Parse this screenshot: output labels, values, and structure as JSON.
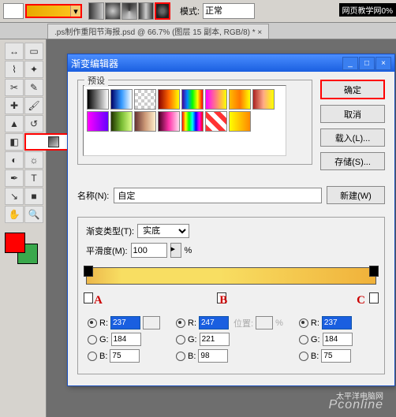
{
  "topbar": {
    "mode_label": "模式:",
    "mode_value": "正常",
    "watermark": "网页教学网0%"
  },
  "tab": {
    "title": ".ps制作重阳节海报.psd @ 66.7% (图层 15 副本, RGB/8) * ×"
  },
  "dialog": {
    "title": "渐变编辑器",
    "preset_legend": "预设",
    "buttons": {
      "ok": "确定",
      "cancel": "取消",
      "load": "载入(L)...",
      "save": "存储(S)...",
      "new": "新建(W)"
    },
    "name_label": "名称(N):",
    "name_value": "自定",
    "grad_type_label": "渐变类型(T):",
    "grad_type_value": "实底",
    "smooth_label": "平滑度(M):",
    "smooth_value": "100",
    "smooth_unit": "%",
    "stops_extra": {
      "pos_label": "位置:",
      "pct": "%"
    },
    "marks": {
      "a": "A",
      "b": "B",
      "c": "C"
    },
    "rgb": {
      "a": {
        "r": "237",
        "g": "184",
        "b": "75"
      },
      "b": {
        "r": "247",
        "g": "221",
        "b": "98"
      },
      "c": {
        "r": "237",
        "g": "184",
        "b": "75"
      }
    }
  },
  "watermark": {
    "brand": "Pconline",
    "sub": "太平洋电脑网"
  },
  "presets_css": [
    "linear-gradient(90deg,#000,#fff)",
    "linear-gradient(90deg,#006,#39f,#fff)",
    "repeating-conic-gradient(#ccc 0 25%,#fff 0 50%) 0/8px 8px",
    "linear-gradient(90deg,#800,#f60,#ff0)",
    "linear-gradient(90deg,#409,#08f,#0f0,#ff0,#f00)",
    "linear-gradient(90deg,#f0f,#ff0)",
    "linear-gradient(90deg,#fb0,#f70,#ff0)",
    "linear-gradient(90deg,#a22,#fa8,#ff0)",
    "linear-gradient(90deg,#f0f,#60f)",
    "linear-gradient(90deg,#230,#7b3,#df8)",
    "linear-gradient(90deg,#633,#c97,#fec)",
    "linear-gradient(90deg,#402,#f3a,#fde)",
    "linear-gradient(90deg,red,#ff0,#0f0,#0ff,#00f,#f0f,red)",
    "repeating-linear-gradient(45deg,#f33 0 6px,#fff 6px 12px)",
    "linear-gradient(90deg,#ff0,#f80)"
  ]
}
